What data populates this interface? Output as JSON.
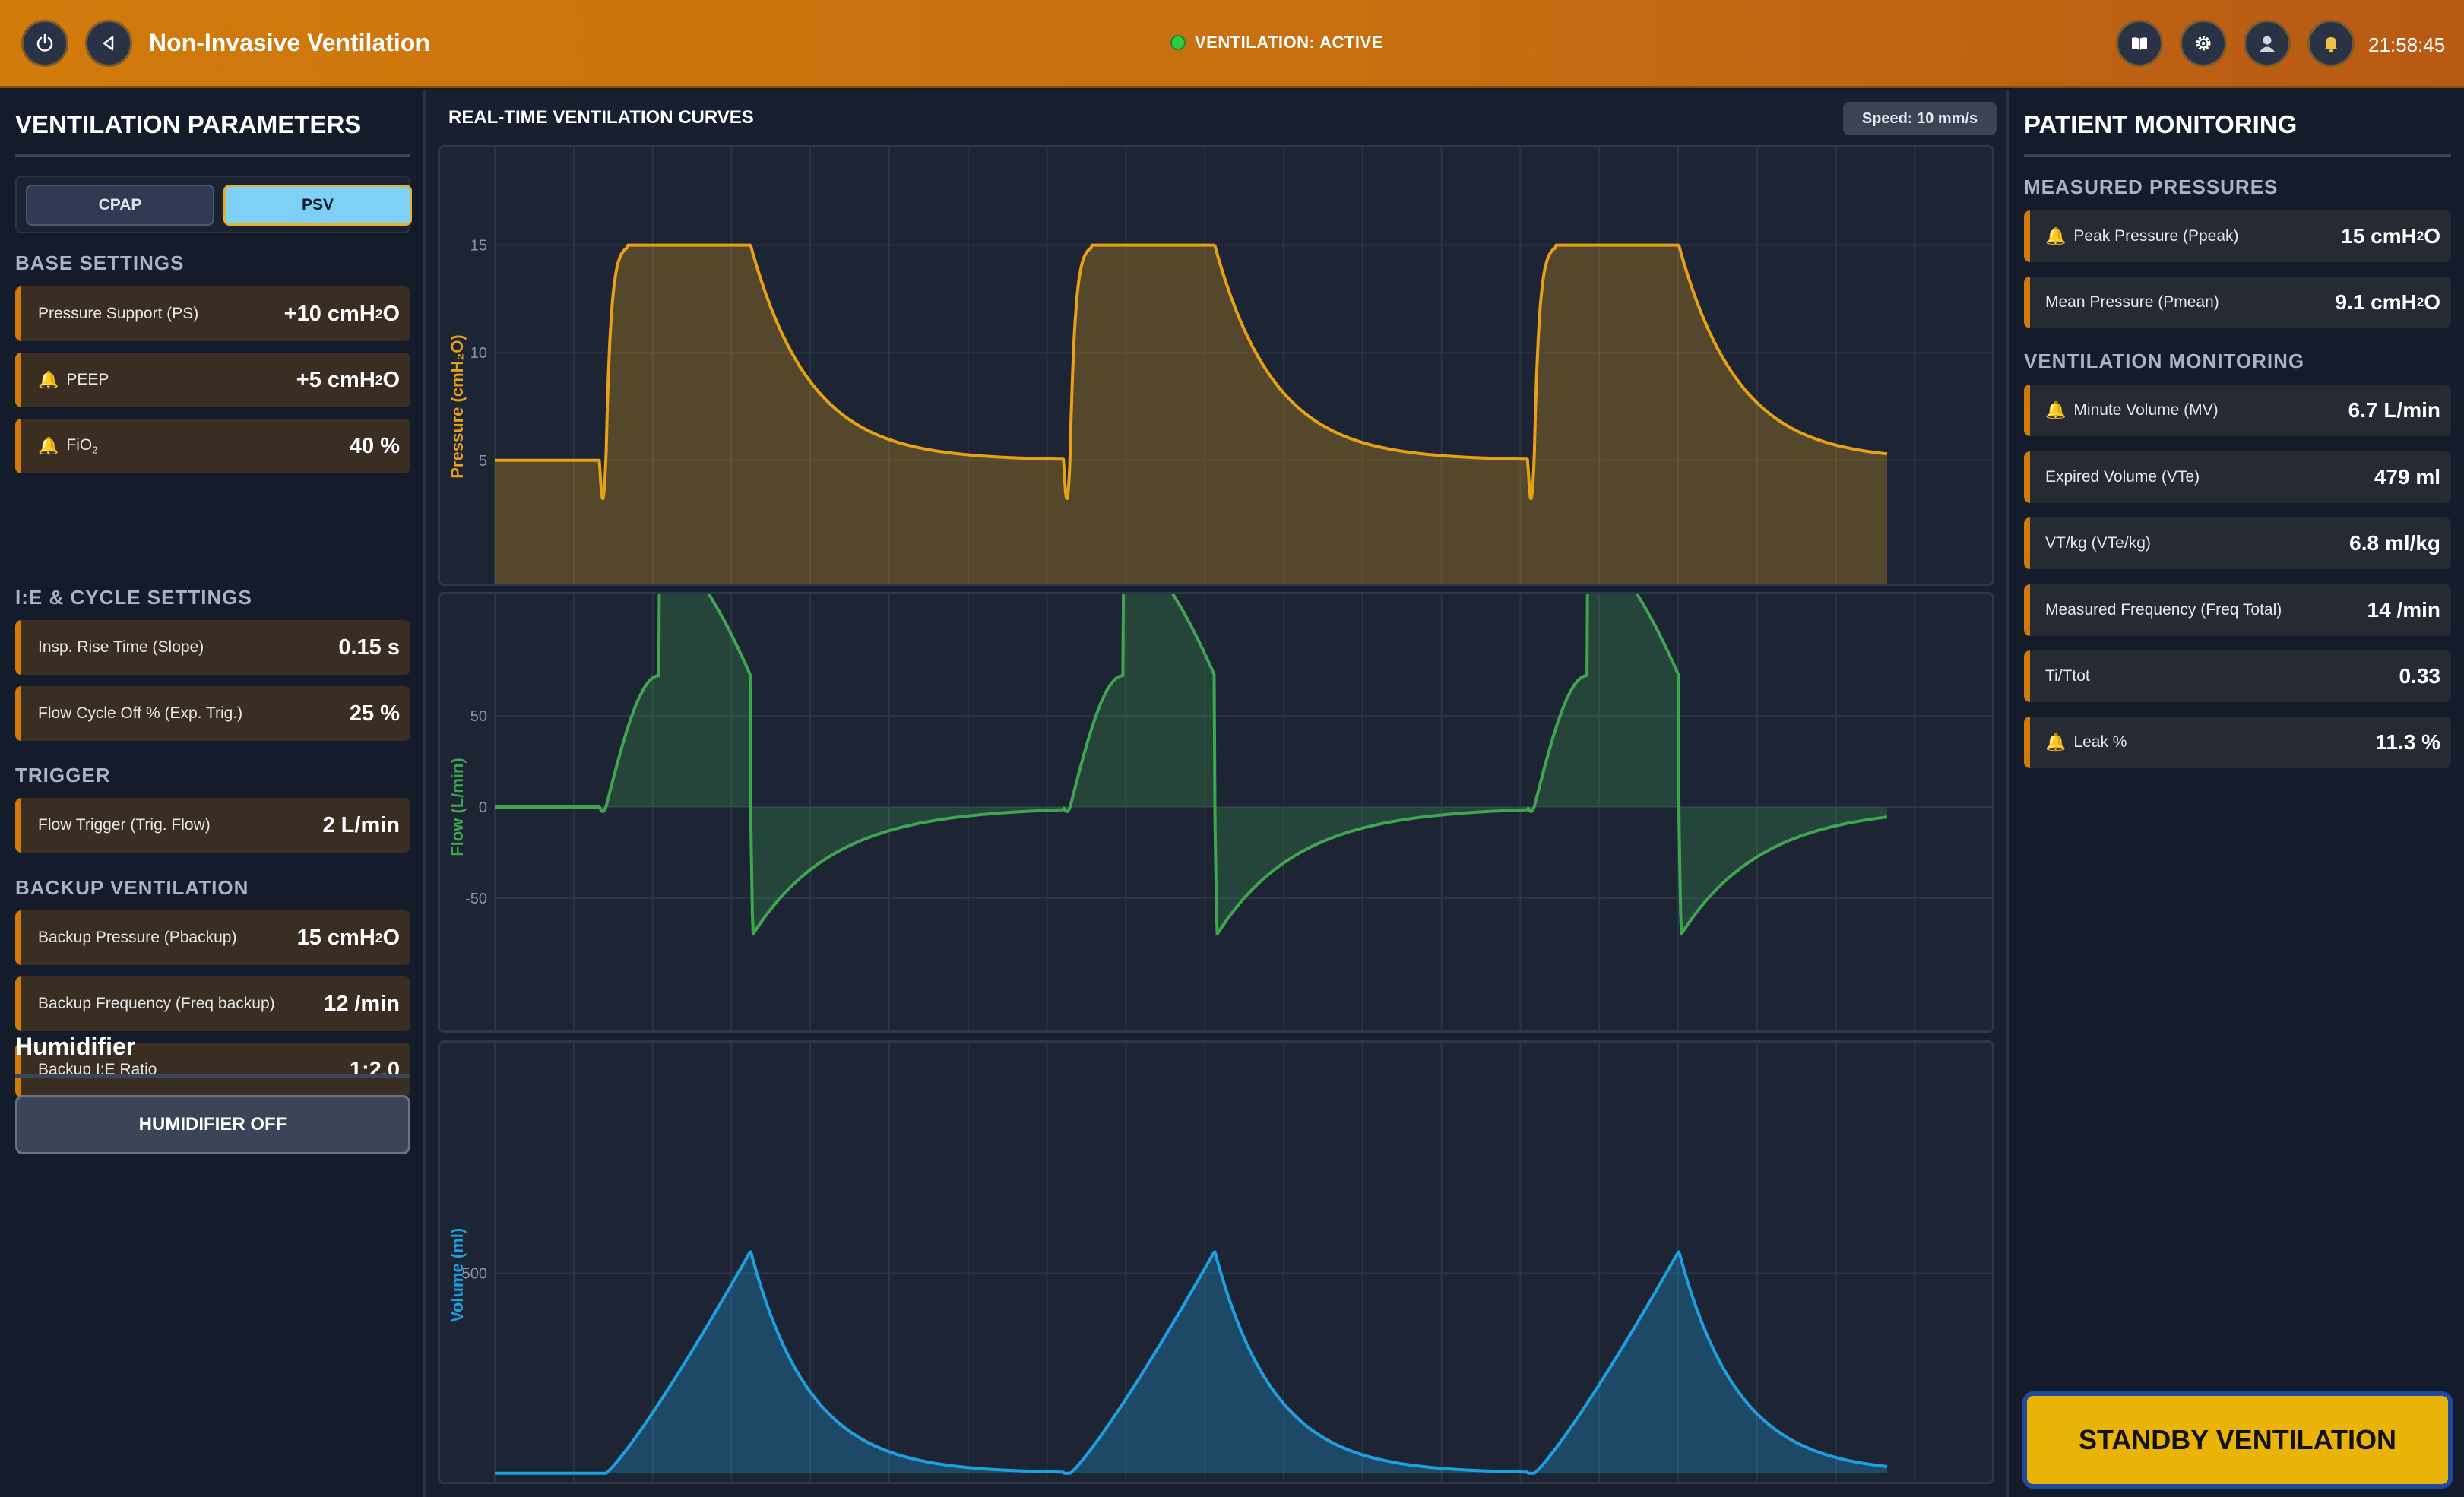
{
  "header": {
    "title": "Non-Invasive Ventilation",
    "status": "VENTILATION: ACTIVE",
    "time": "21:58:45",
    "icons": [
      "power-icon",
      "back-icon",
      "book-icon",
      "gear-icon",
      "user-icon",
      "bell-icon"
    ]
  },
  "left": {
    "title": "VENTILATION PARAMETERS",
    "modes": [
      "CPAP",
      "PSV"
    ],
    "active_mode": "PSV",
    "sections": {
      "base": "BASE SETTINGS",
      "ie": "I:E & CYCLE SETTINGS",
      "trigger": "TRIGGER",
      "backup": "BACKUP VENTILATION"
    },
    "params": {
      "ps": {
        "label": "Pressure Support (PS)",
        "value": "+10",
        "unit": "cmH2O"
      },
      "peep": {
        "label": "PEEP",
        "value": "+5",
        "unit": "cmH2O"
      },
      "fio2": {
        "label": "FiO",
        "value": "40 %"
      },
      "slope": {
        "label": "Insp. Rise Time (Slope)",
        "value": "0.15 s"
      },
      "cycle": {
        "label": "Flow Cycle Off % (Exp. Trig.)",
        "value": "25 %"
      },
      "trig": {
        "label": "Flow Trigger (Trig. Flow)",
        "value": "2 L/min"
      },
      "pbackup": {
        "label": "Backup Pressure (Pbackup)",
        "value": "15",
        "unit": "cmH2O"
      },
      "fbackup": {
        "label": "Backup Frequency (Freq backup)",
        "value": "12 /min"
      },
      "iebackup": {
        "label": "Backup I:E Ratio",
        "value": "1:2.0"
      }
    },
    "humidifier": {
      "title": "Humidifier",
      "button": "HUMIDIFIER OFF"
    }
  },
  "center": {
    "title": "REAL-TIME VENTILATION CURVES",
    "speed": "Speed: 10 mm/s"
  },
  "right": {
    "title": "PATIENT MONITORING",
    "sections": {
      "pressures": "MEASURED PRESSURES",
      "ventilation": "VENTILATION MONITORING"
    },
    "values": {
      "ppeak": {
        "label": "Peak Pressure (Ppeak)",
        "value": "15",
        "unit": "cmH2O"
      },
      "pmean": {
        "label": "Mean Pressure (Pmean)",
        "value": "9.1",
        "unit": "cmH2O"
      },
      "mv": {
        "label": "Minute Volume (MV)",
        "value": "6.7 L/min"
      },
      "vte": {
        "label": "Expired Volume (VTe)",
        "value": "479 ml"
      },
      "vtkg": {
        "label": "VT/kg (VTe/kg)",
        "value": "6.8 ml/kg"
      },
      "freq": {
        "label": "Measured Frequency (Freq Total)",
        "value": "14 /min"
      },
      "titot": {
        "label": "Ti/Ttot",
        "value": "0.33"
      },
      "leak": {
        "label": "Leak %",
        "value": "11.3 %"
      }
    },
    "standby_button": "STANDBY VENTILATION"
  },
  "colors": {
    "pressure": "#e6a117",
    "flow": "#3fa64f",
    "volume": "#1e9fdf",
    "accent": "#d07a0c",
    "active_mode": "#7fd0f7",
    "standby": "#eab308"
  },
  "chart_data": [
    {
      "type": "line",
      "ylabel": "Pressure (cmH₂O)",
      "yticks": [
        5,
        10,
        15
      ],
      "ylim": [
        -2,
        17
      ],
      "breath_period_s": 4.3,
      "breaths": 3,
      "peep": 5,
      "peak": 15,
      "series": [
        {
          "values_note_free": true
        }
      ]
    },
    {
      "type": "line",
      "ylabel": "Flow (L/min)",
      "yticks": [
        -50,
        0,
        50
      ],
      "ylim": [
        -100,
        100
      ],
      "peak_inspiratory": 72,
      "peak_expiratory": -70
    },
    {
      "type": "line",
      "ylabel": "Volume (ml)",
      "yticks": [
        500
      ],
      "ylim": [
        -10,
        1000
      ],
      "peak": 555
    }
  ]
}
